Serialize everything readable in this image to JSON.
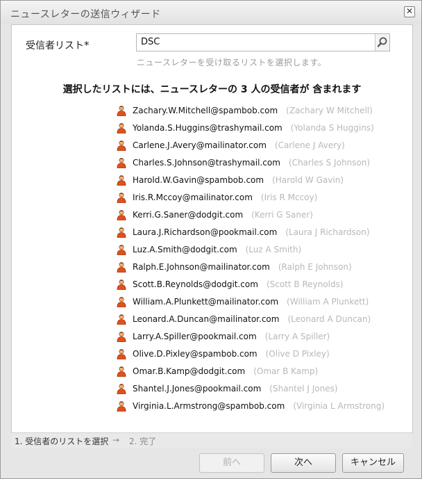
{
  "window": {
    "title": "ニュースレターの送信ウィザード",
    "close_glyph": "✕"
  },
  "form": {
    "label": "受信者リスト",
    "required_mark": "*",
    "input_value": "DSC",
    "hint": "ニュースレターを受け取るリストを選択します。"
  },
  "summary": "選択したリストには、ニュースレターの 3 人の受信者が 含まれます",
  "recipients": [
    {
      "email": "Zachary.W.Mitchell@spambob.com",
      "name": "(Zachary W Mitchell)"
    },
    {
      "email": "Yolanda.S.Huggins@trashymail.com",
      "name": "(Yolanda S Huggins)"
    },
    {
      "email": "Carlene.J.Avery@mailinator.com",
      "name": "(Carlene J Avery)"
    },
    {
      "email": "Charles.S.Johnson@trashymail.com",
      "name": "(Charles S Johnson)"
    },
    {
      "email": "Harold.W.Gavin@spambob.com",
      "name": "(Harold W Gavin)"
    },
    {
      "email": "Iris.R.Mccoy@mailinator.com",
      "name": "(Iris R Mccoy)"
    },
    {
      "email": "Kerri.G.Saner@dodgit.com",
      "name": "(Kerri G Saner)"
    },
    {
      "email": "Laura.J.Richardson@pookmail.com",
      "name": "(Laura J Richardson)"
    },
    {
      "email": "Luz.A.Smith@dodgit.com",
      "name": "(Luz A Smith)"
    },
    {
      "email": "Ralph.E.Johnson@mailinator.com",
      "name": "(Ralph E Johnson)"
    },
    {
      "email": "Scott.B.Reynolds@dodgit.com",
      "name": "(Scott B Reynolds)"
    },
    {
      "email": "William.A.Plunkett@mailinator.com",
      "name": "(William A Plunkett)"
    },
    {
      "email": "Leonard.A.Duncan@mailinator.com",
      "name": "(Leonard A Duncan)"
    },
    {
      "email": "Larry.A.Spiller@pookmail.com",
      "name": "(Larry A Spiller)"
    },
    {
      "email": "Olive.D.Pixley@spambob.com",
      "name": "(Olive D Pixley)"
    },
    {
      "email": "Omar.B.Kamp@dodgit.com",
      "name": "(Omar B Kamp)"
    },
    {
      "email": "Shantel.J.Jones@pookmail.com",
      "name": "(Shantel J Jones)"
    },
    {
      "email": "Virginia.L.Armstrong@spambob.com",
      "name": "(Virginia L Armstrong)"
    }
  ],
  "steps": {
    "step1": "1. 受信者のリストを選択",
    "arrow": "→",
    "step2": "2. 完了"
  },
  "buttons": {
    "prev": "前へ",
    "next": "次へ",
    "cancel": "キャンセル"
  },
  "icons": {
    "search": "search-icon",
    "person": "person-icon"
  }
}
